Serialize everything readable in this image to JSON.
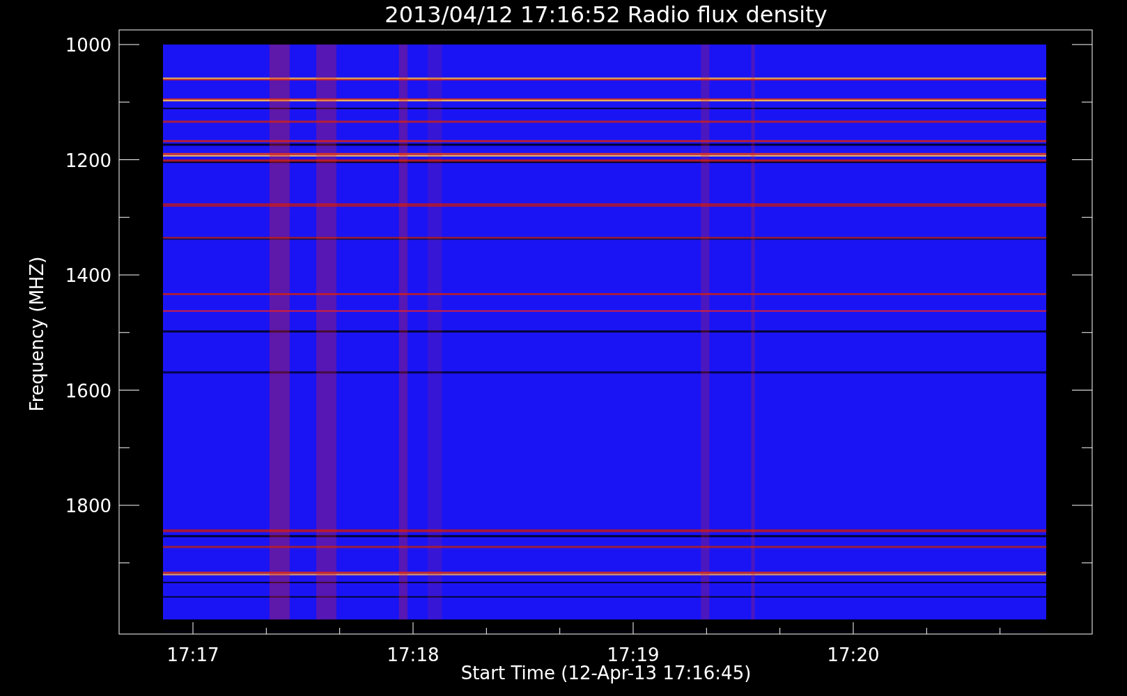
{
  "title": "2013/04/12 17:16:52 Radio flux density",
  "y_axis": {
    "label": "Frequency (MHZ)",
    "ticks": [
      "1000",
      "1200",
      "1400",
      "1600",
      "1800"
    ]
  },
  "x_axis": {
    "label": "Start Time (12-Apr-13 17:16:45)",
    "ticks": [
      "17:17",
      "17:18",
      "17:19",
      "17:20"
    ]
  }
}
